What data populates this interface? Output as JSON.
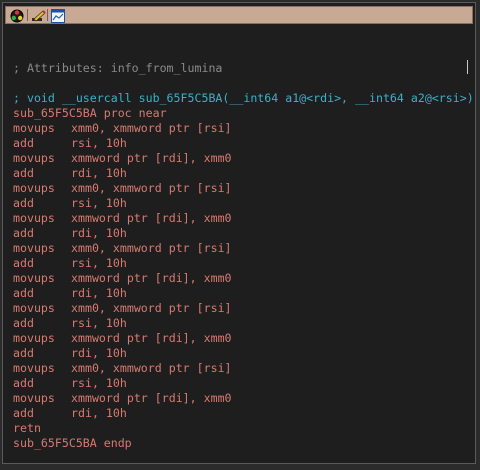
{
  "toolbar": {
    "icons": [
      "graph-color-icon",
      "edit-pencil-icon",
      "chart-window-icon"
    ]
  },
  "listing": {
    "comment": "; Attributes: info_from_lumina",
    "prototype": "; void __usercall sub_65F5C5BA(__int64 a1@<rdi>, __int64 a2@<rsi>)",
    "proc_start": "sub_65F5C5BA proc near",
    "instructions": [
      {
        "mnemonic": "movups",
        "operands": "xmm0, xmmword ptr [rsi]"
      },
      {
        "mnemonic": "add",
        "operands": "rsi, 10h"
      },
      {
        "mnemonic": "movups",
        "operands": "xmmword ptr [rdi], xmm0"
      },
      {
        "mnemonic": "add",
        "operands": "rdi, 10h"
      },
      {
        "mnemonic": "movups",
        "operands": "xmm0, xmmword ptr [rsi]"
      },
      {
        "mnemonic": "add",
        "operands": "rsi, 10h"
      },
      {
        "mnemonic": "movups",
        "operands": "xmmword ptr [rdi], xmm0"
      },
      {
        "mnemonic": "add",
        "operands": "rdi, 10h"
      },
      {
        "mnemonic": "movups",
        "operands": "xmm0, xmmword ptr [rsi]"
      },
      {
        "mnemonic": "add",
        "operands": "rsi, 10h"
      },
      {
        "mnemonic": "movups",
        "operands": "xmmword ptr [rdi], xmm0"
      },
      {
        "mnemonic": "add",
        "operands": "rdi, 10h"
      },
      {
        "mnemonic": "movups",
        "operands": "xmm0, xmmword ptr [rsi]"
      },
      {
        "mnemonic": "add",
        "operands": "rsi, 10h"
      },
      {
        "mnemonic": "movups",
        "operands": "xmmword ptr [rdi], xmm0"
      },
      {
        "mnemonic": "add",
        "operands": "rdi, 10h"
      },
      {
        "mnemonic": "movups",
        "operands": "xmm0, xmmword ptr [rsi]"
      },
      {
        "mnemonic": "add",
        "operands": "rsi, 10h"
      },
      {
        "mnemonic": "movups",
        "operands": "xmmword ptr [rdi], xmm0"
      },
      {
        "mnemonic": "add",
        "operands": "rdi, 10h"
      },
      {
        "mnemonic": "retn",
        "operands": ""
      }
    ],
    "proc_end": "sub_65F5C5BA endp"
  },
  "colors": {
    "comment": "#8a8a8a",
    "prototype": "#3db0c8",
    "code": "#d77a70",
    "background": "#1e1e1e",
    "toolbar": "#c8a994"
  }
}
